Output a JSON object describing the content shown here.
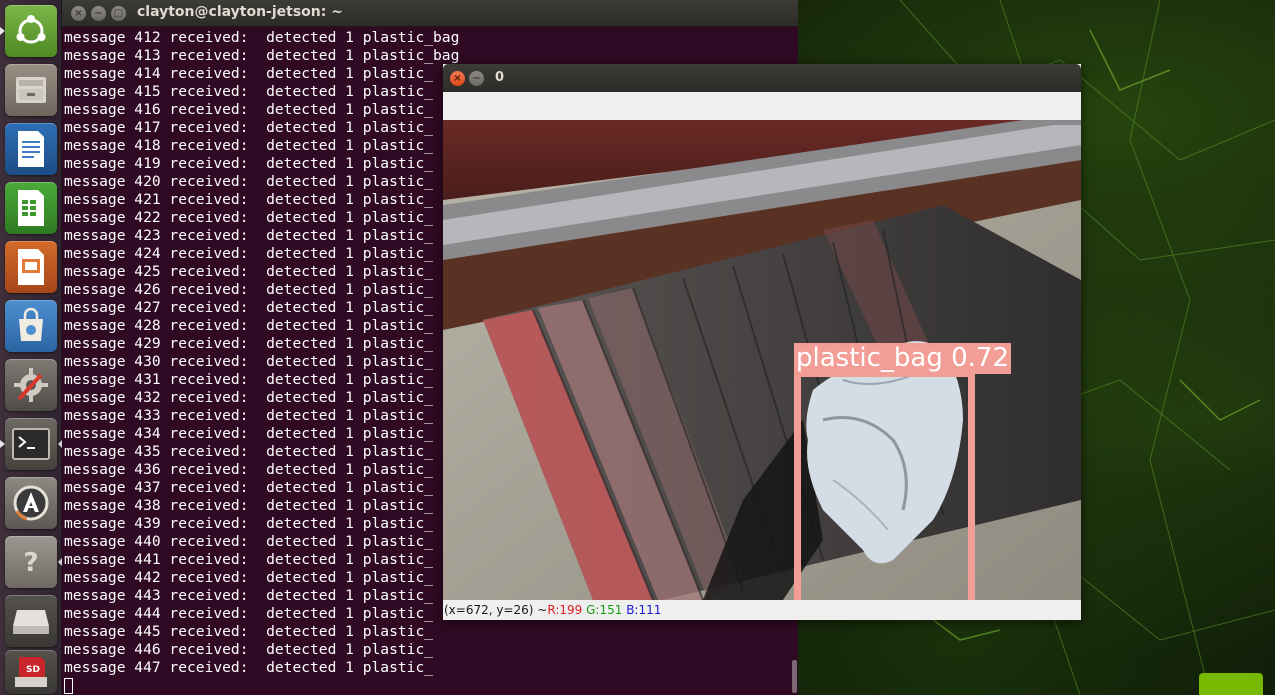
{
  "launcher": {
    "items": [
      {
        "name": "ubuntu-dash-icon"
      },
      {
        "name": "files-icon"
      },
      {
        "name": "writer-icon"
      },
      {
        "name": "calc-icon"
      },
      {
        "name": "impress-icon"
      },
      {
        "name": "software-center-icon"
      },
      {
        "name": "system-settings-icon"
      },
      {
        "name": "terminal-icon"
      },
      {
        "name": "software-updater-icon"
      },
      {
        "name": "help-icon"
      },
      {
        "name": "removable-drive-icon"
      },
      {
        "name": "sd-card-icon"
      }
    ],
    "sd_label": "SD"
  },
  "terminal": {
    "title": "clayton@clayton-jetson: ~",
    "lines": [
      "message 412 received:  detected 1 plastic_bag",
      "message 413 received:  detected 1 plastic_bag",
      "message 414 received:  detected 1 plastic_",
      "message 415 received:  detected 1 plastic_",
      "message 416 received:  detected 1 plastic_",
      "message 417 received:  detected 1 plastic_",
      "message 418 received:  detected 1 plastic_",
      "message 419 received:  detected 1 plastic_",
      "message 420 received:  detected 1 plastic_",
      "message 421 received:  detected 1 plastic_",
      "message 422 received:  detected 1 plastic_",
      "message 423 received:  detected 1 plastic_",
      "message 424 received:  detected 1 plastic_",
      "message 425 received:  detected 1 plastic_",
      "message 426 received:  detected 1 plastic_",
      "message 427 received:  detected 1 plastic_",
      "message 428 received:  detected 1 plastic_",
      "message 429 received:  detected 1 plastic_",
      "message 430 received:  detected 1 plastic_",
      "message 431 received:  detected 1 plastic_",
      "message 432 received:  detected 1 plastic_",
      "message 433 received:  detected 1 plastic_",
      "message 434 received:  detected 1 plastic_",
      "message 435 received:  detected 1 plastic_",
      "message 436 received:  detected 1 plastic_",
      "message 437 received:  detected 1 plastic_",
      "message 438 received:  detected 1 plastic_",
      "message 439 received:  detected 1 plastic_",
      "message 440 received:  detected 1 plastic_",
      "message 441 received:  detected 1 plastic_",
      "message 442 received:  detected 1 plastic_",
      "message 443 received:  detected 1 plastic_",
      "message 444 received:  detected 1 plastic_",
      "message 445 received:  detected 1 plastic_",
      "message 446 received:  detected 1 plastic_",
      "message 447 received:  detected 1 plastic_"
    ]
  },
  "viewer": {
    "title": "0",
    "detection_label": "plastic_bag 0.72",
    "status": {
      "coords": "(x=672, y=26) ~ ",
      "r": "R:199",
      "g": "G:151",
      "b": "B:111"
    }
  },
  "colors": {
    "terminal_bg": "#300a24",
    "detection_box": "#f29d95",
    "status_r": "#e01b1b",
    "status_g": "#1a9a1a",
    "status_b": "#1a1ad0"
  }
}
